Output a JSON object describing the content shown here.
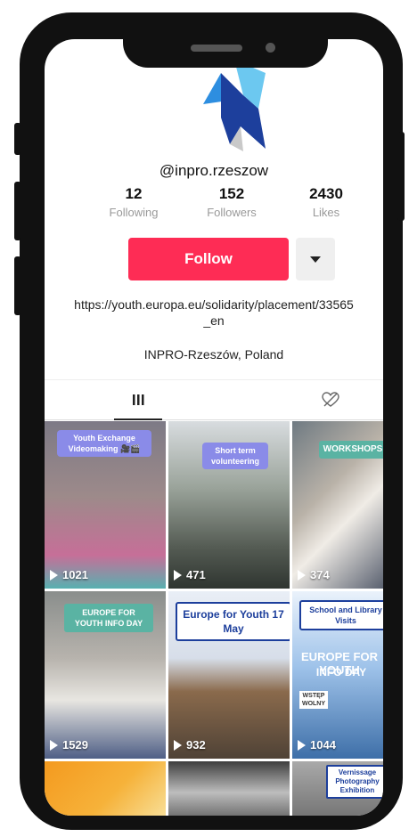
{
  "profile": {
    "handle": "@inpro.rzeszow",
    "stats": [
      {
        "value": "12",
        "label": "Following"
      },
      {
        "value": "152",
        "label": "Followers"
      },
      {
        "value": "2430",
        "label": "Likes"
      }
    ],
    "follow_label": "Follow",
    "bio": "https://youth.europa.eu/solidarity/placement/33565_en",
    "location": "INPRO-Rzeszów, Poland"
  },
  "tabs": [
    {
      "icon": "grid-icon",
      "active": true
    },
    {
      "icon": "liked-videos-icon",
      "active": false
    }
  ],
  "videos": [
    {
      "views": "1021",
      "caption": "Youth Exchange Videomaking 🎥🎬"
    },
    {
      "views": "471",
      "caption": "Short term volunteering"
    },
    {
      "views": "374",
      "caption": "WORKSHOPS"
    },
    {
      "views": "1529",
      "caption": "EUROPE FOR YOUTH INFO DAY"
    },
    {
      "views": "932",
      "caption": "Europe for Youth 17 May"
    },
    {
      "views": "1044",
      "caption": "School and Library Visits"
    },
    {
      "views": "",
      "caption": ""
    },
    {
      "views": "",
      "caption": ""
    },
    {
      "views": "",
      "caption": "Vernissage Photography Exhibition"
    }
  ],
  "video6_poster": {
    "headline": "EUROPE FOR YOUTH",
    "sub": "INFO DAY",
    "sign_left": "WSTĘP WOLNY"
  },
  "colors": {
    "follow": "#fe2c55",
    "accent_logo": "#1d4fb8"
  }
}
